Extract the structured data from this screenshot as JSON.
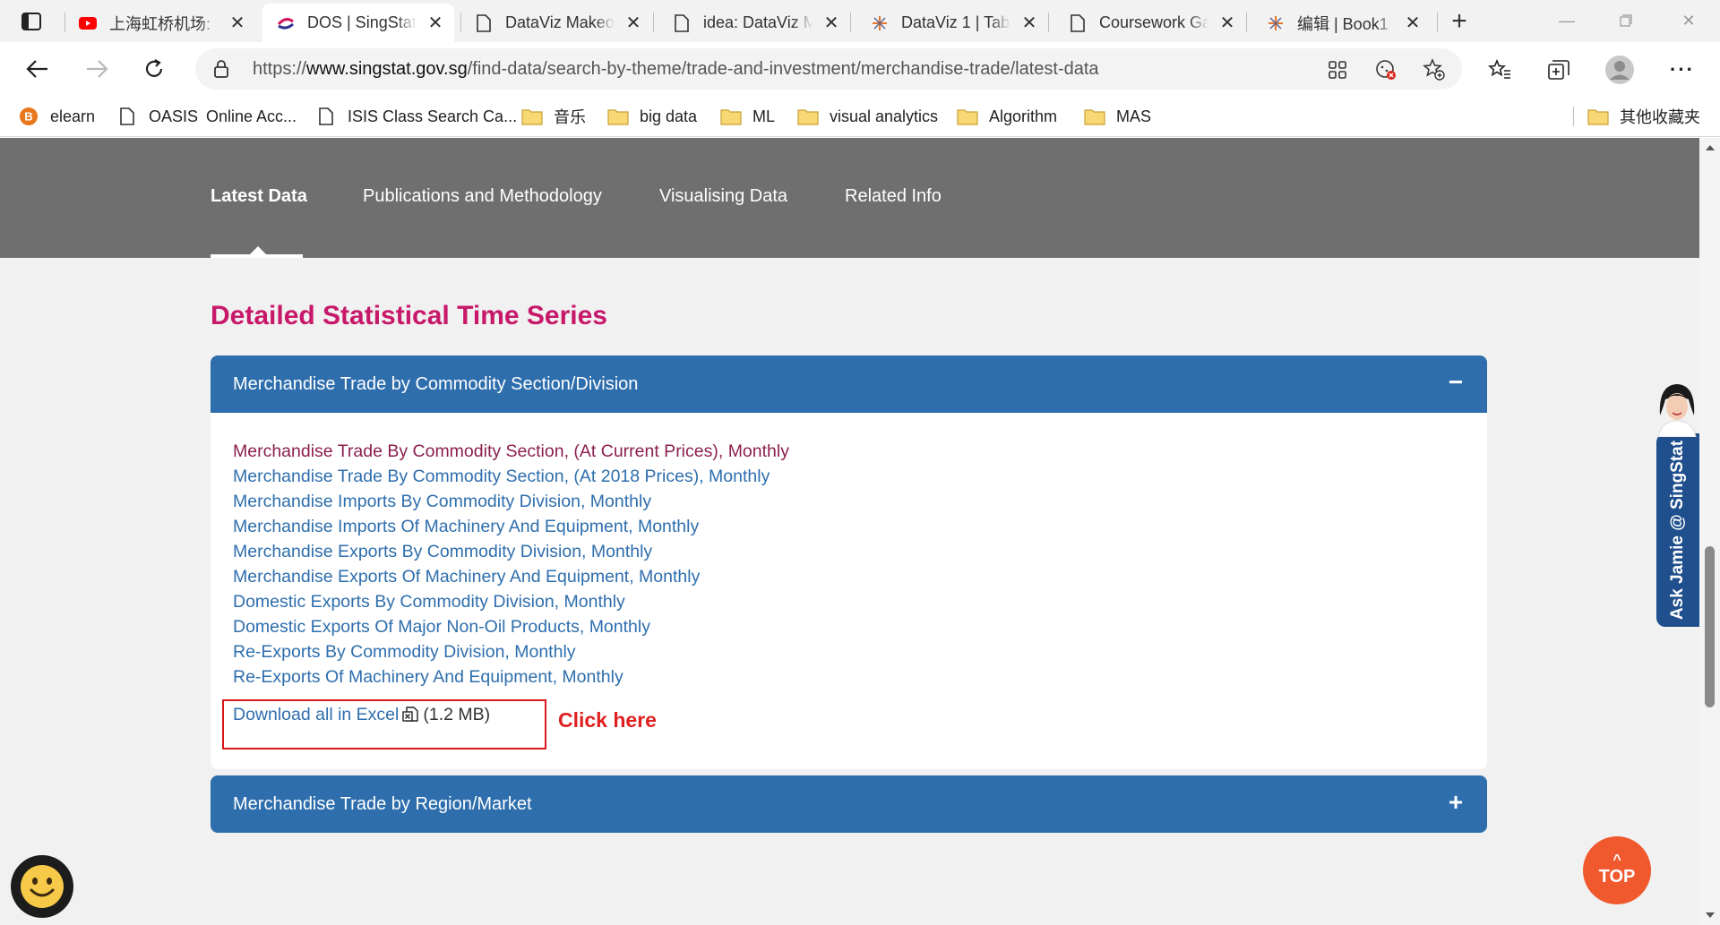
{
  "browser": {
    "tabs": [
      {
        "title": "上海虹桥机场:",
        "favicon": "youtube-icon",
        "active": false
      },
      {
        "title": "DOS | SingStat",
        "favicon": "singstat-icon",
        "active": true
      },
      {
        "title": "DataViz Makeo",
        "favicon": "page-icon",
        "active": false
      },
      {
        "title": "idea: DataViz M",
        "favicon": "page-icon",
        "active": false
      },
      {
        "title": "DataViz 1 | Tabl",
        "favicon": "tableau-icon",
        "active": false
      },
      {
        "title": "Coursework Ga",
        "favicon": "page-icon",
        "active": false
      },
      {
        "title": "编辑 | Book1",
        "favicon": "tableau-icon",
        "active": false
      }
    ],
    "close_glyph": "✕",
    "new_tab_glyph": "+",
    "address": {
      "prefix": "https://",
      "domain": "www.singstat.gov.sg",
      "path": "/find-data/search-by-theme/trade-and-investment/merchandise-trade/latest-data"
    },
    "bookmarks": [
      {
        "label": "elearn",
        "icon": "elearn-icon"
      },
      {
        "label": "OASIS",
        "icon": "page-icon"
      },
      {
        "label": "Online Acc...",
        "icon": "none"
      },
      {
        "label": "ISIS Class Search Ca...",
        "icon": "page-icon"
      },
      {
        "label": "音乐",
        "icon": "folder-icon"
      },
      {
        "label": "big data",
        "icon": "folder-icon"
      },
      {
        "label": "ML",
        "icon": "folder-icon"
      },
      {
        "label": "visual analytics",
        "icon": "folder-icon"
      },
      {
        "label": "Algorithm",
        "icon": "folder-icon"
      },
      {
        "label": "MAS",
        "icon": "folder-icon"
      }
    ],
    "other_bookmarks": "其他收藏夹"
  },
  "page": {
    "subnav": {
      "tabs": [
        "Latest Data",
        "Publications and Methodology",
        "Visualising Data",
        "Related Info"
      ],
      "active_index": 0
    },
    "section_title": "Detailed Statistical Time Series",
    "accordions": [
      {
        "title": "Merchandise Trade by Commodity Section/Division",
        "expanded": true,
        "toggle": "−",
        "links": [
          {
            "text": "Merchandise Trade By Commodity Section, (At Current Prices), Monthly",
            "visited": true
          },
          {
            "text": "Merchandise Trade By Commodity Section, (At 2018 Prices), Monthly",
            "visited": false
          },
          {
            "text": "Merchandise Imports By Commodity Division, Monthly",
            "visited": false
          },
          {
            "text": "Merchandise Imports Of Machinery And Equipment, Monthly",
            "visited": false
          },
          {
            "text": "Merchandise Exports By Commodity Division, Monthly",
            "visited": false
          },
          {
            "text": "Merchandise Exports Of Machinery And Equipment, Monthly",
            "visited": false
          },
          {
            "text": "Domestic Exports By Commodity Division, Monthly",
            "visited": false
          },
          {
            "text": "Domestic Exports Of Major Non-Oil Products, Monthly",
            "visited": false
          },
          {
            "text": "Re-Exports By Commodity Division, Monthly",
            "visited": false
          },
          {
            "text": "Re-Exports Of Machinery And Equipment, Monthly",
            "visited": false
          }
        ],
        "download": {
          "label": "Download all in Excel",
          "size": "(1.2 MB)"
        },
        "annotation": "Click here"
      },
      {
        "title": "Merchandise Trade by Region/Market",
        "expanded": false,
        "toggle": "+"
      }
    ],
    "ask_jamie": "Ask Jamie @ SingStat",
    "top_button": {
      "arrow": "^",
      "label": "TOP"
    }
  },
  "colors": {
    "section_title": "#c7186a",
    "accordion_header": "#2e6ead",
    "link": "#2e6ead",
    "visited_link": "#8b1f4e",
    "annotation": "#e02020",
    "top_button": "#f0592e",
    "grey_nav": "#6f6f6f"
  }
}
